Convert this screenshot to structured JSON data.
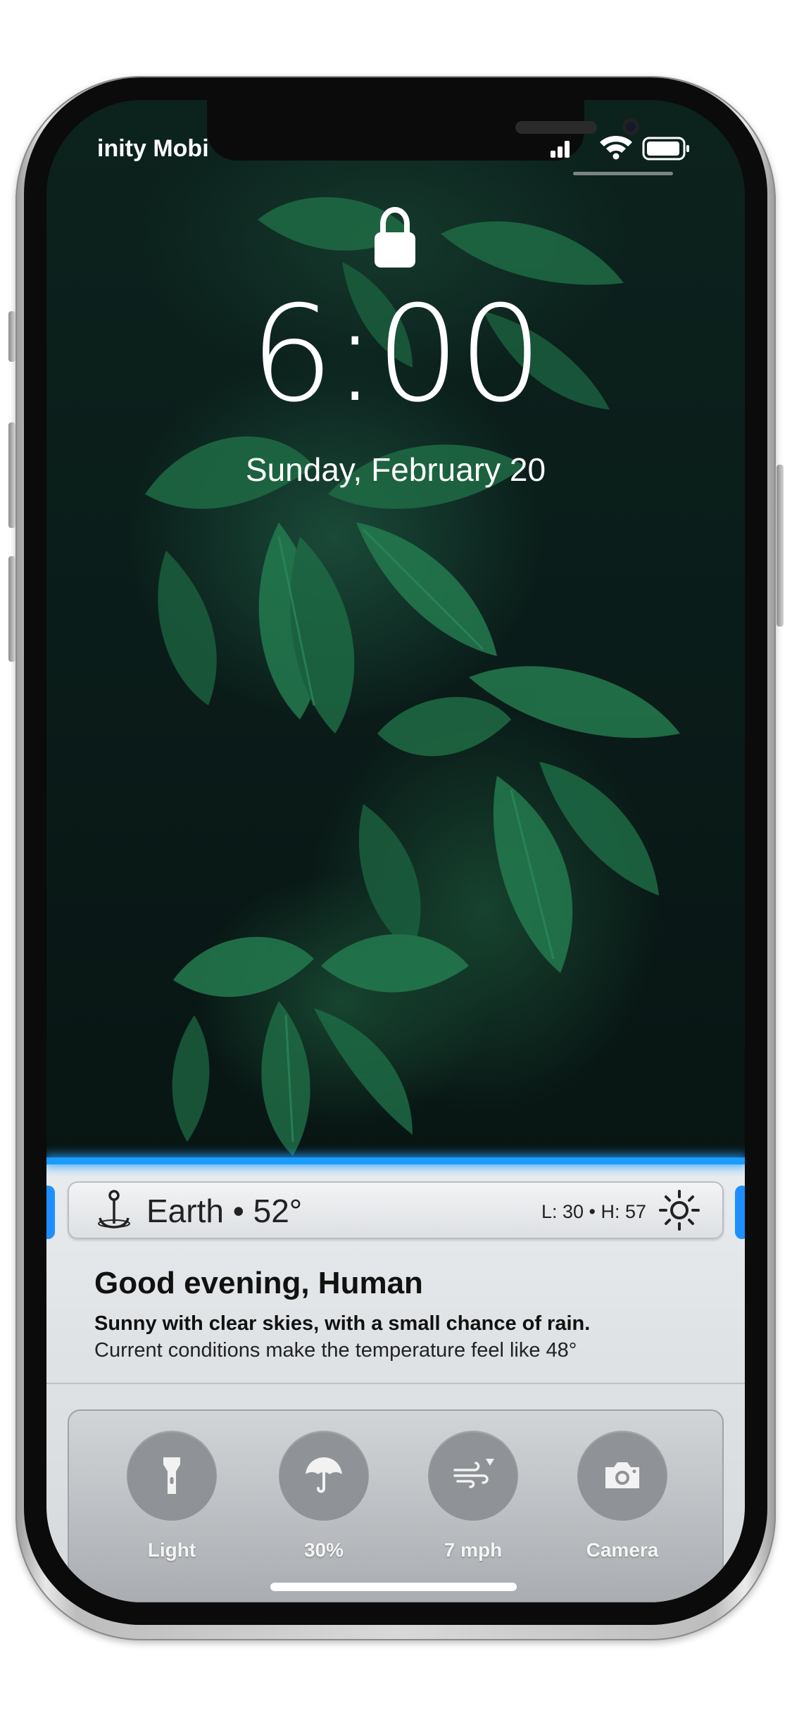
{
  "status_bar": {
    "carrier": "inity Mobi"
  },
  "lock_screen": {
    "time": "6:00",
    "date": "Sunday, February 20"
  },
  "weather_bar": {
    "location": "Earth • 52°",
    "low_high": "L: 30 • H: 57"
  },
  "forecast": {
    "greeting": "Good evening, Human",
    "summary": "Sunny with clear skies, with a small chance of rain.",
    "feels_like": "Current conditions make the temperature feel like 48°"
  },
  "controls": [
    {
      "label": "Light",
      "icon": "flashlight-icon"
    },
    {
      "label": "30%",
      "icon": "umbrella-icon"
    },
    {
      "label": "7 mph",
      "icon": "wind-icon"
    },
    {
      "label": "Camera",
      "icon": "camera-icon"
    }
  ],
  "colors": {
    "accent": "#1a9cff",
    "panel": "#dfe3e6",
    "control_circle": "#8f9296"
  }
}
